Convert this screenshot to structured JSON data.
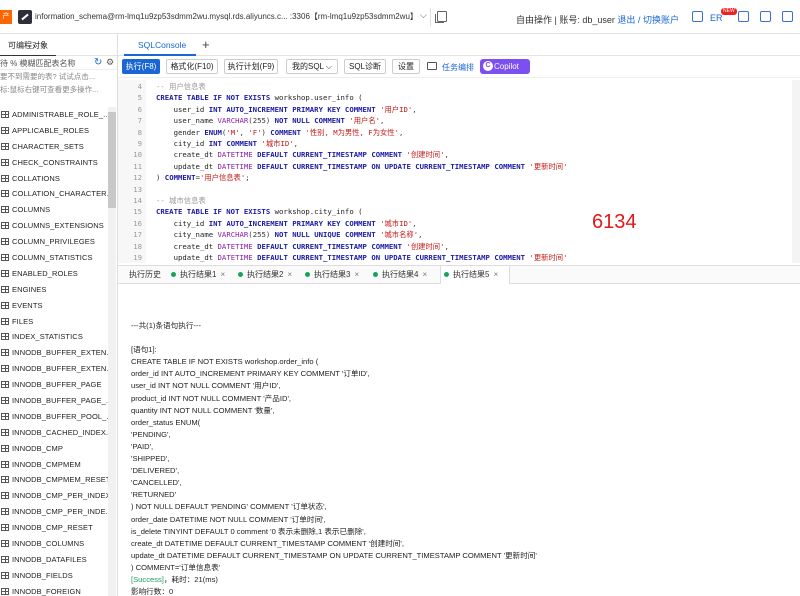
{
  "topbar": {
    "app_logo": "产",
    "connection": "information_schema@rm-lmq1u9zp53sdmm2wu.mysql.rds.aliyuncs.c... :3306【rm-lmq1u9zp53sdmm2wu】",
    "caret": "⌵",
    "user_prefix": "自由操作 | 账号: db_user",
    "logout": "退出",
    "separator": "/",
    "switch_account": "切换账户",
    "lang": "ER",
    "new_badge": "NEW"
  },
  "sidebar": {
    "tab_label": "可编程对象",
    "search_text": "待 % 模糊匹配表名称",
    "hint1": "要不到需要的表? 试试点击...",
    "hint2": "标:鼠标右键可查看更多操作...",
    "items": [
      "ADMINISTRABLE_ROLE_...",
      "APPLICABLE_ROLES",
      "CHARACTER_SETS",
      "CHECK_CONSTRAINTS",
      "COLLATIONS",
      "COLLATION_CHARACTER...",
      "COLUMNS",
      "COLUMNS_EXTENSIONS",
      "COLUMN_PRIVILEGES",
      "COLUMN_STATISTICS",
      "ENABLED_ROLES",
      "ENGINES",
      "EVENTS",
      "FILES",
      "INDEX_STATISTICS",
      "INNODB_BUFFER_EXTEN...",
      "INNODB_BUFFER_EXTEN...",
      "INNODB_BUFFER_PAGE",
      "INNODB_BUFFER_PAGE_...",
      "INNODB_BUFFER_POOL_...",
      "INNODB_CACHED_INDEX...",
      "INNODB_CMP",
      "INNODB_CMPMEM",
      "INNODB_CMPMEM_RESET",
      "INNODB_CMP_PER_INDEX",
      "INNODB_CMP_PER_INDE...",
      "INNODB_CMP_RESET",
      "INNODB_COLUMNS",
      "INNODB_DATAFILES",
      "INNODB_FIELDS",
      "INNODB_FOREIGN"
    ]
  },
  "tabs": {
    "console_tab": "SQLConsole",
    "add": "+"
  },
  "toolbar": {
    "execute": "执行(F8)",
    "format": "格式化(F10)",
    "plan": "执行计划(F9)",
    "mysql": "我的SQL ⌵",
    "diagnose": "SQL诊断",
    "settings": "设置",
    "task": "任务编排",
    "copilot": "Copilot"
  },
  "editor": {
    "lines": [
      {
        "n": "4",
        "html": "<span class='cm'>-- 用户信息表</span>"
      },
      {
        "n": "5",
        "html": "<span class='kw'>CREATE TABLE IF NOT EXISTS</span> <span class='nm'>workshop.user_info (</span>"
      },
      {
        "n": "6",
        "html": "    <span class='nm'>user_id</span> <span class='kw'>INT AUTO_INCREMENT PRIMARY KEY COMMENT</span> <span class='str'>'用户ID'</span>,"
      },
      {
        "n": "7",
        "html": "    <span class='nm'>user_name</span> <span class='ty'>VARCHAR</span>(255) <span class='kw'>NOT NULL COMMENT</span> <span class='str'>'用户名'</span>,"
      },
      {
        "n": "8",
        "html": "    <span class='nm'>gender</span> <span class='kw'>ENUM</span>(<span class='str'>'M'</span>, <span class='str'>'F'</span>) <span class='kw'>COMMENT</span> <span class='str'>'性别, M为男性, F为女性'</span>,"
      },
      {
        "n": "9",
        "html": "    <span class='nm'>city_id</span> <span class='kw'>INT COMMENT</span> <span class='str'>'城市ID'</span>,"
      },
      {
        "n": "10",
        "html": "    <span class='nm'>create_dt</span> <span class='ty'>DATETIME</span> <span class='kw'>DEFAULT CURRENT_TIMESTAMP COMMENT</span> <span class='str'>'创建时间'</span>,"
      },
      {
        "n": "11",
        "html": "    <span class='nm'>update_dt</span> <span class='ty'>DATETIME</span> <span class='kw'>DEFAULT CURRENT_TIMESTAMP ON UPDATE CURRENT_TIMESTAMP COMMENT</span> <span class='str'>'更新时间'</span>"
      },
      {
        "n": "12",
        "html": ") <span class='kw'>COMMENT</span>=<span class='str'>'用户信息表'</span>;"
      },
      {
        "n": "13",
        "html": ""
      },
      {
        "n": "14",
        "html": "<span class='cm'>-- 城市信息表</span>"
      },
      {
        "n": "15",
        "html": "<span class='kw'>CREATE TABLE IF NOT EXISTS</span> <span class='nm'>workshop.city_info (</span>"
      },
      {
        "n": "16",
        "html": "    <span class='nm'>city_id</span> <span class='kw'>INT AUTO_INCREMENT PRIMARY KEY COMMENT</span> <span class='str'>'城市ID'</span>,"
      },
      {
        "n": "17",
        "html": "    <span class='nm'>city_name</span> <span class='ty'>VARCHAR</span>(255) <span class='kw'>NOT NULL UNIQUE COMMENT</span> <span class='str'>'城市名称'</span>,"
      },
      {
        "n": "18",
        "html": "    <span class='nm'>create_dt</span> <span class='ty'>DATETIME</span> <span class='kw'>DEFAULT CURRENT_TIMESTAMP COMMENT</span> <span class='str'>'创建时间'</span>,"
      },
      {
        "n": "19",
        "html": "    <span class='nm'>update_dt</span> <span class='ty'>DATETIME</span> <span class='kw'>DEFAULT CURRENT_TIMESTAMP ON UPDATE CURRENT_TIMESTAMP COMMENT</span> <span class='str'>'更新时间'</span>"
      },
      {
        "n": "20",
        "html": ") <span class='kw'>COMMENT</span>=<span class='str'>'城市信息表'</span>;"
      }
    ],
    "overlay_number": "6134"
  },
  "result_tabs": [
    {
      "label": "执行历史",
      "dot": false,
      "close": false
    },
    {
      "label": "执行结果1",
      "dot": true,
      "close": true
    },
    {
      "label": "执行结果2",
      "dot": true,
      "close": true
    },
    {
      "label": "执行结果3",
      "dot": true,
      "close": true
    },
    {
      "label": "执行结果4",
      "dot": true,
      "close": true
    },
    {
      "label": "执行结果5",
      "dot": true,
      "close": true,
      "active": true
    }
  ],
  "output": {
    "lines": [
      "---共(1)条语句执行---",
      "",
      "[语句1]:",
      "CREATE TABLE IF NOT EXISTS workshop.order_info (",
      "order_id INT AUTO_INCREMENT PRIMARY KEY COMMENT '订单ID',",
      "user_id INT NOT NULL COMMENT '用户ID',",
      "product_id INT NOT NULL COMMENT '产品ID',",
      "quantity INT NOT NULL COMMENT '数量',",
      "order_status ENUM(",
      "'PENDING',",
      "'PAID',",
      "'SHIPPED',",
      "'DELIVERED',",
      "'CANCELLED',",
      "'RETURNED'",
      ") NOT NULL DEFAULT 'PENDING' COMMENT '订单状态',",
      "order_date DATETIME NOT NULL COMMENT '订单时间',",
      "is_delete TINYINT DEFAULT 0 comment '0 表示未删除,1 表示已删除',",
      "create_dt DATETIME DEFAULT CURRENT_TIMESTAMP COMMENT '创建时间',",
      "update_dt DATETIME DEFAULT CURRENT_TIMESTAMP ON UPDATE CURRENT_TIMESTAMP COMMENT '更新时间'",
      ") COMMENT='订单信息表'"
    ],
    "success_tag": "[Success]",
    "success_rest": "，耗时：21(ms)",
    "affected": "影响行数：0"
  }
}
